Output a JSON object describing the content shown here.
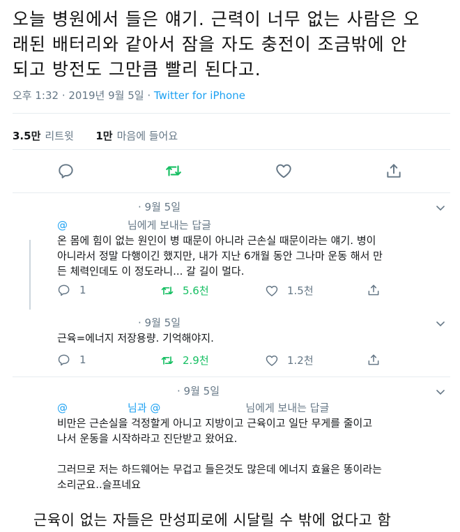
{
  "tweet": {
    "line1": "오늘 병원에서 들은 얘기. 근력이 너무 없는 사람은 오",
    "line2": "래된 배터리와 같아서 잠을 자도 충전이 조금밖에 안",
    "line3": "되고 방전도 그만큼 빨리 된다고.",
    "time": "오후 1:32 · 2019년 9월 5일 · ",
    "source": "Twitter for iPhone",
    "retweet_count": "3.5만",
    "retweet_label": "리트윗",
    "like_count": "1만",
    "like_label": "마음에 들어요"
  },
  "replies": [
    {
      "date": "· 9월 5일",
      "to_at": "@",
      "to_suffix": "님에게 보내는 답글",
      "lines": [
        "온 몸에 힘이 없는 원인이 병 때문이 아니라 근손실 때문이라는 얘기. 병이",
        "아니라서 정말 다행이긴 했지만, 내가 지난 6개월 동안 그나마 운동 해서 만",
        "든 체력인데도 이 정도라니... 갈 길이 멀다."
      ],
      "replies_count": "1",
      "retweets": "5.6천",
      "likes": "1.5천"
    },
    {
      "date": "· 9월 5일",
      "lines": [
        "근육=에너지 저장용량. 기억해야지."
      ],
      "replies_count": "1",
      "retweets": "2.9천",
      "likes": "1.2천"
    },
    {
      "date": "· 9월 5일",
      "to_at": "@",
      "to_mid": "님과 @",
      "to_suffix": "님에게 보내는 답글",
      "lines": [
        "비만은 근손실을 걱정할게 아니고 지방이고 근육이고 일단 무게를 줄이고",
        "나서 운동을 시작하라고 진단받고 왔어요.",
        "",
        "그러므로 저는 하드웨어는 무겁고 들은것도 많은데 에너지 효율은 똥이라는",
        "소리군요..슬프네요"
      ]
    }
  ],
  "caption": "근육이 없는 자들은 만성피로에 시달릴 수 밖에 없다고 함",
  "colors": {
    "accent": "#1da1f2",
    "retweet_green": "#17bf63",
    "muted": "#657786"
  }
}
